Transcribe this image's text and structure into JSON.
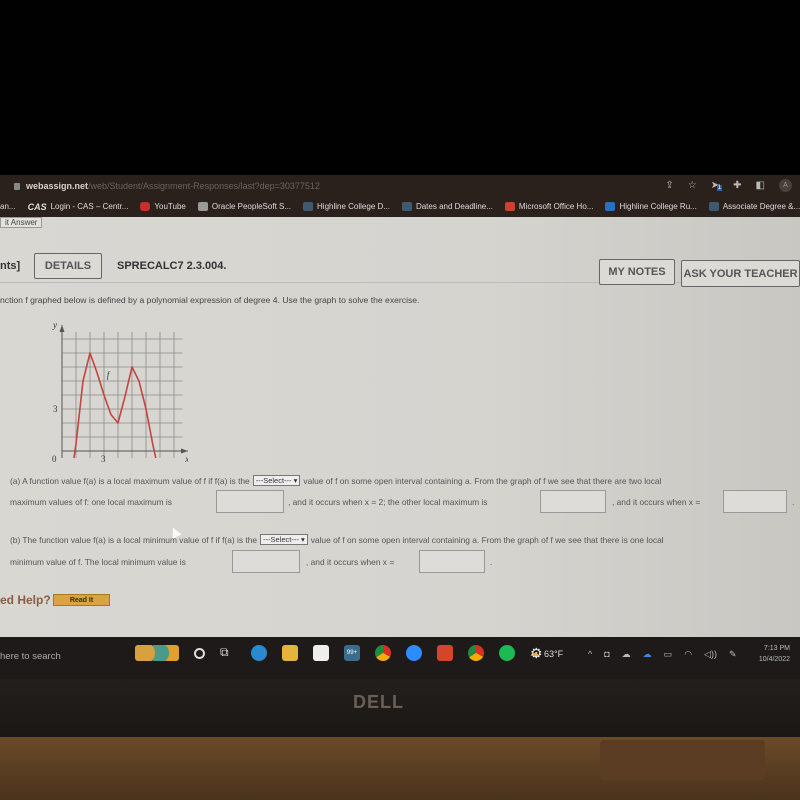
{
  "browser": {
    "url_host": "webassign.net",
    "url_path": "/web/Student/Assignment-Responses/last?dep=30377512",
    "toolbar_icons": [
      "share-icon",
      "star-icon",
      "extension-badge-icon",
      "puzzle-icon",
      "sidebar-icon"
    ],
    "extension_badge": "1",
    "profile_initial": "A",
    "bookmarks": [
      {
        "label": "an...",
        "icon": "none"
      },
      {
        "label": "Login - CAS – Centr...",
        "icon": "cas-icon"
      },
      {
        "label": "YouTube",
        "icon": "youtube-icon"
      },
      {
        "label": "Oracle PeopleSoft S...",
        "icon": "oracle-icon"
      },
      {
        "label": "Highline College D...",
        "icon": "hc-icon"
      },
      {
        "label": "Dates and Deadline...",
        "icon": "hc-icon"
      },
      {
        "label": "Microsoft Office Ho...",
        "icon": "office-icon"
      },
      {
        "label": "Highline College Ru...",
        "icon": "outlook-icon"
      },
      {
        "label": "Associate Degree &...",
        "icon": "hc-icon"
      }
    ]
  },
  "page": {
    "submit_tab": "it Answer",
    "points_label": "nts]",
    "details_button": "DETAILS",
    "problem_code": "SPRECALC7 2.3.004.",
    "my_notes_button": "MY NOTES",
    "ask_teacher_button": "ASK YOUR TEACHER",
    "intro": "nction f graphed below is defined by a polynomial expression of degree 4. Use the graph to solve the exercise.",
    "graph": {
      "y_axis_label": "y",
      "x_axis_label": "x",
      "curve_label": "f",
      "tick_labels": {
        "origin": "0",
        "x": "3",
        "y": "3"
      }
    },
    "part_a": {
      "line1_pre": "(a) A function value f(a) is a local maximum value of f if f(a) is the",
      "select_value": "---Select---",
      "line1_post": "value of f on some open interval containing a. From the graph of f we see that there are two local",
      "line2_a": "maximum values of f: one local maximum is",
      "line2_b": ", and it occurs when  x = 2;  the other local maximum is",
      "line2_c": ", and it occurs when  x =",
      "line2_end": ".",
      "answer1": "",
      "answer2": "",
      "answer3": ""
    },
    "part_b": {
      "line1_pre": "(b) The function value f(a) is a local minimum value of f if f(a) is the",
      "select_value": "---Select---",
      "line1_post": "value of f on some open interval containing a. From the graph of f we see that there is one local",
      "line2_a": "minimum value of f. The local minimum value is",
      "line2_b": ", and it occurs when  x =",
      "line2_end": ".",
      "answer1": "",
      "answer2": ""
    },
    "need_help": "ed Help?",
    "read_it_button": "Read It"
  },
  "taskbar": {
    "search_text": "here to search",
    "apps": [
      "widgets-icon",
      "cortana-icon",
      "task-view-icon",
      "edge-icon",
      "file-explorer-icon",
      "store-icon",
      "mail-icon",
      "chrome-icon",
      "zoom-icon",
      "office-icon",
      "chrome-profile-icon",
      "spotify-icon",
      "settings-icon"
    ],
    "mail_badge": "99+",
    "weather_temp": "63°F",
    "tray_icons": [
      "chevron-up-icon",
      "meet-icon",
      "onedrive-icon",
      "onedrive-blue-icon",
      "battery-icon",
      "wifi-icon",
      "volume-icon",
      "pen-icon"
    ],
    "time": "7:13 PM",
    "date": "10/4/2022"
  },
  "device": {
    "brand": "DELL"
  },
  "chart_data": {
    "type": "line",
    "title": "",
    "xlabel": "x",
    "ylabel": "y",
    "xlim": [
      0,
      8
    ],
    "ylim": [
      -0.5,
      9
    ],
    "grid": true,
    "x_tick_labels": [
      {
        "value": 0,
        "label": "0"
      },
      {
        "value": 3,
        "label": "3"
      }
    ],
    "y_tick_labels": [
      {
        "value": 3,
        "label": "3"
      }
    ],
    "series": [
      {
        "name": "f",
        "color": "#c0463f",
        "x": [
          0.85,
          1,
          1.5,
          2,
          2.5,
          3,
          3.5,
          4,
          4.5,
          5,
          5.5,
          6,
          6.5,
          6.7
        ],
        "y": [
          -0.5,
          0.5,
          5.0,
          7.0,
          5.6,
          4.0,
          2.6,
          2.0,
          3.9,
          6.0,
          5.0,
          3.0,
          0.4,
          -0.5
        ]
      }
    ],
    "annotations": [
      {
        "text": "f",
        "x": 3.2,
        "y": 5.2
      }
    ]
  }
}
